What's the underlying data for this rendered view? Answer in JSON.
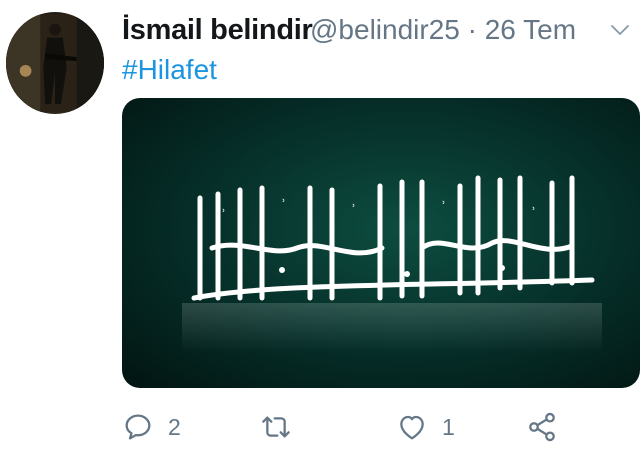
{
  "tweet": {
    "display_name": "İsmail belindir",
    "handle_time": "@belindir25 · 26 Tem",
    "hashtag": "#Hilafet",
    "media": {
      "calligraphy_text": "لا إله إلا الله محمد رسول الله"
    }
  },
  "actions": {
    "reply": {
      "icon": "reply-icon",
      "count": "2"
    },
    "retweet": {
      "icon": "retweet-icon",
      "count": ""
    },
    "like": {
      "icon": "heart-icon",
      "count": "1"
    },
    "share": {
      "icon": "share-icon"
    }
  },
  "colors": {
    "name": "#14171a",
    "muted": "#657786",
    "link": "#1b95e0",
    "media_bg": "#06302a"
  }
}
